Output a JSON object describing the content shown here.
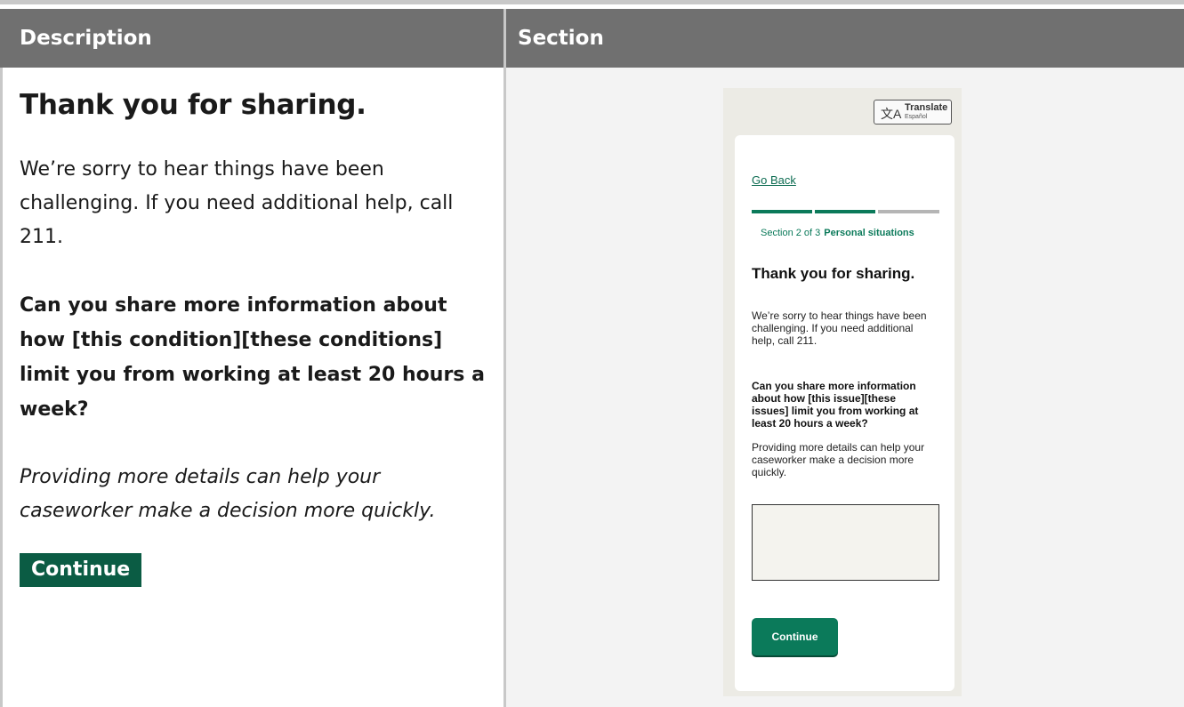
{
  "table": {
    "headers": [
      "Description",
      "Section"
    ]
  },
  "description": {
    "title": "Thank you for sharing.",
    "body": "We’re sorry to hear things have been challenging. If you need additional help, call 211.",
    "question": "Can you share more information about how [this condition][these conditions] limit you from working at least 20 hours a week?",
    "hint": "Providing more details can help your caseworker make a decision more quickly.",
    "continue_label": "Continue"
  },
  "phone": {
    "translate_label": "Translate",
    "translate_sub": "Español",
    "translate_icon": "translate-icon",
    "go_back": "Go Back",
    "progress": {
      "current": 2,
      "total": 3
    },
    "section_prefix": "Section 2 of 3",
    "section_name": "Personal situations",
    "title": "Thank you for sharing.",
    "body": "We’re sorry to hear things have been challenging. If you need additional help, call 211.",
    "question": "Can you share more information about how [this issue][these issues] limit you from working at least 20 hours a week?",
    "hint": "Providing more details can help your caseworker make a decision more quickly.",
    "textarea_value": "",
    "continue_label": "Continue"
  },
  "colors": {
    "header_bg": "#707070",
    "accent_green": "#0b7a5a",
    "dark_green": "#0b5c44"
  }
}
